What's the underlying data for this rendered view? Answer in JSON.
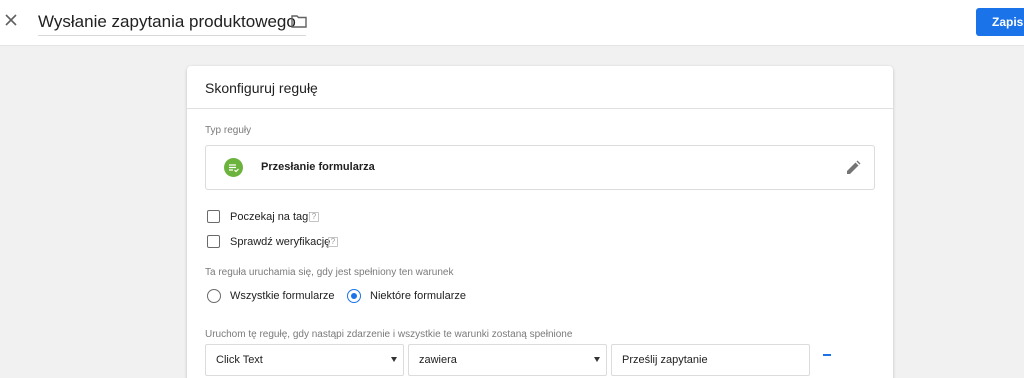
{
  "header": {
    "title": "Wysłanie zapytania produktowego",
    "save_label": "Zapis"
  },
  "card": {
    "title": "Skonfiguruj regułę",
    "trigger_type_label": "Typ reguły",
    "trigger_type_value": "Przesłanie formularza",
    "checkboxes": [
      {
        "label": "Poczekaj na tagi",
        "checked": false
      },
      {
        "label": "Sprawdź weryfikację",
        "checked": false
      }
    ],
    "fire_condition_label": "Ta reguła uruchamia się, gdy jest spełniony ten warunek",
    "radio_options": [
      {
        "label": "Wszystkie formularze",
        "selected": false
      },
      {
        "label": "Niektóre formularze",
        "selected": true
      }
    ],
    "filter_label": "Uruchom tę regułę, gdy nastąpi zdarzenie i wszystkie te warunki zostaną spełnione",
    "filter": {
      "variable": "Click Text",
      "operator": "zawiera",
      "value": "Prześlij zapytanie"
    }
  },
  "colors": {
    "accent": "#1a73e8",
    "trigger_icon": "#6cb33e",
    "background": "#f1f1f2"
  },
  "icons": [
    "close-icon",
    "folder-icon",
    "form-submission-icon",
    "edit-pencil-icon",
    "help-icon",
    "dropdown-caret-icon",
    "remove-icon"
  ]
}
